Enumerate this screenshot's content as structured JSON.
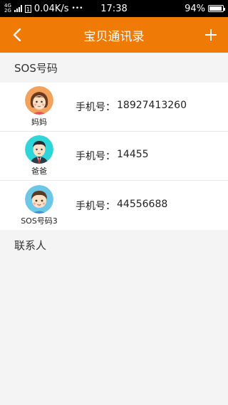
{
  "status_bar": {
    "network_top": "4G",
    "network_bottom": "2G",
    "sim_label": "1",
    "speed": "0.04K/s",
    "more": "•••",
    "time": "17:38",
    "battery": "94%",
    "battery_level": 0.94
  },
  "header": {
    "title": "宝贝通讯录",
    "back_icon": "chevron-left-icon",
    "add_icon": "plus-icon"
  },
  "sections": {
    "sos_title": "SOS号码",
    "contacts_title": "联系人"
  },
  "phone_label": "手机号：",
  "sos_contacts": [
    {
      "name": "妈妈",
      "phone": "18927413260",
      "avatar": "mother-avatar-icon",
      "avatar_color": "#f2a25c"
    },
    {
      "name": "爸爸",
      "phone": "14455",
      "avatar": "father-avatar-icon",
      "avatar_color": "#2fd6d9"
    },
    {
      "name": "SOS号码3",
      "phone": "44556688",
      "avatar": "child-avatar-icon",
      "avatar_color": "#6cc6e6"
    }
  ],
  "colors": {
    "accent": "#ef7a06",
    "background": "#f4f4f4"
  }
}
